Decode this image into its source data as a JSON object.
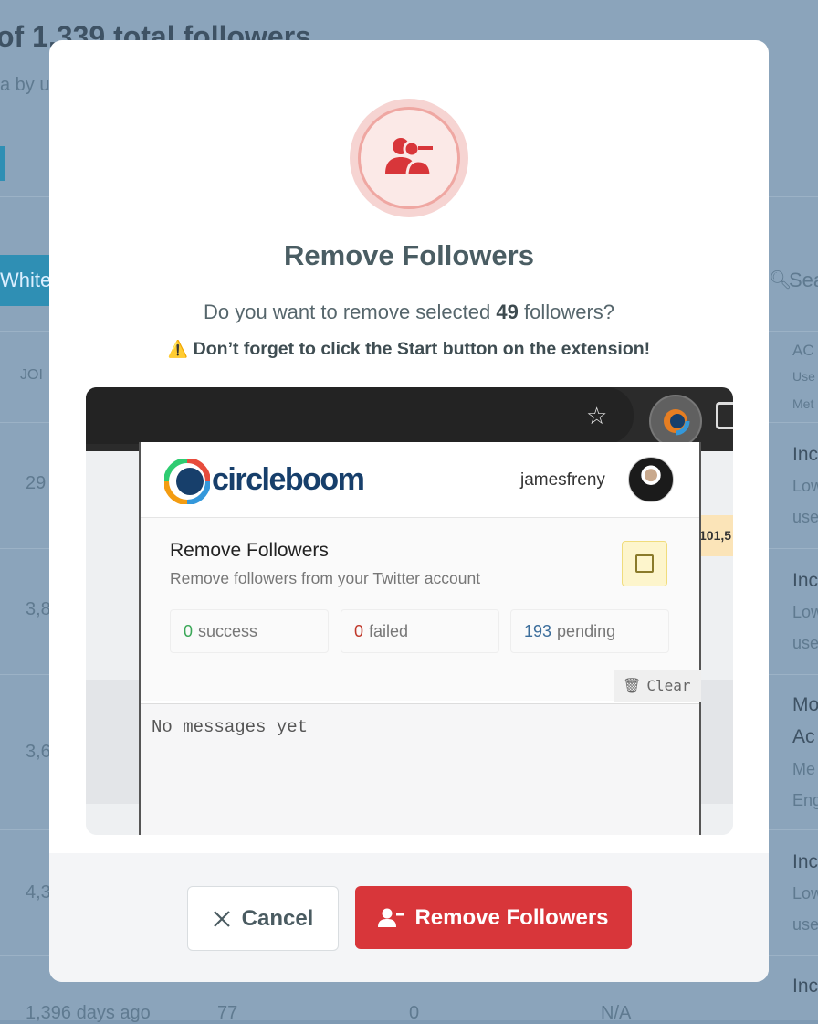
{
  "background": {
    "header_title": "of 1,339 total followers",
    "header_sub": "a by u",
    "pill": "White",
    "search_placeholder": "Sea",
    "col_join": "JOI",
    "col_ac": "AC",
    "col_ac_sub1": "Use",
    "col_ac_sub2": "Met",
    "rows": [
      {
        "left": "29",
        "r1": "Inc",
        "r2": "Low",
        "r3": "use"
      },
      {
        "left": "3,8",
        "r1": "Inc",
        "r2": "Low",
        "r3": "use"
      },
      {
        "left": "3,6",
        "r1": "Mo",
        "r2": "Ac",
        "r3": "Me",
        "r4": "Eng"
      },
      {
        "left": "4,3",
        "r1": "Inc",
        "r2": "Low",
        "r3": "use"
      }
    ],
    "bottom_row": {
      "a": "1,396 days ago",
      "b": "77",
      "c": "0",
      "d": "N/A",
      "e": "Inc"
    }
  },
  "modal": {
    "icon": "user-minus-icon",
    "title": "Remove Followers",
    "question_pre": "Do you want to remove selected",
    "question_count": "49",
    "question_post": "followers?",
    "warning_icon": "⚠️",
    "warning_text": "Don’t forget to click the Start button on the extension!",
    "screenshot": {
      "logo_text": "circleboom",
      "username": "jamesfreny",
      "side_tag": "101,5",
      "panel_title": "Remove Followers",
      "panel_subtitle": "Remove followers from your Twitter account",
      "stats": [
        {
          "num": "0",
          "label": "success",
          "color": "#3aa757"
        },
        {
          "num": "0",
          "label": "failed",
          "color": "#c0392b"
        },
        {
          "num": "193",
          "label": "pending",
          "color": "#3b6d9b"
        }
      ],
      "clear_label": "Clear",
      "log_text": "No messages yet"
    },
    "cancel_label": "Cancel",
    "remove_label": "Remove Followers"
  }
}
